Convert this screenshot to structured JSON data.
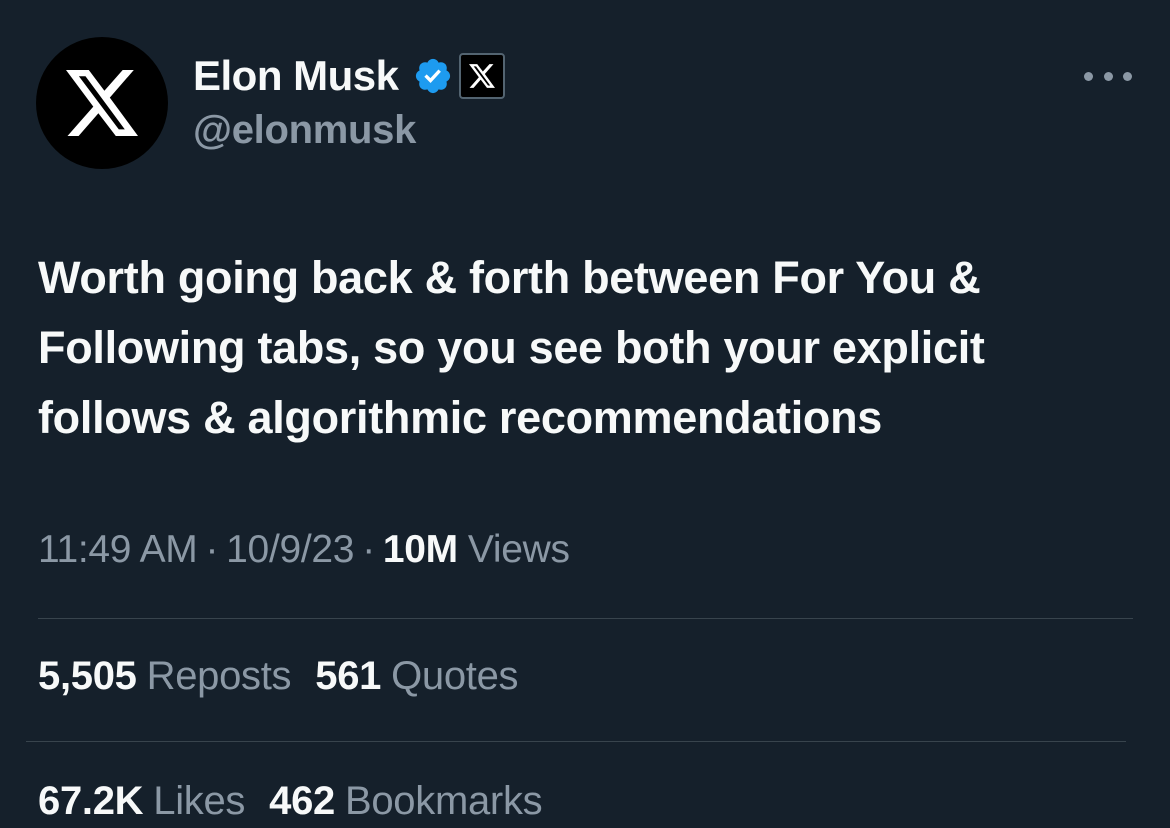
{
  "author": {
    "display_name": "Elon Musk",
    "handle": "@elonmusk",
    "avatar_icon": "x-logo-icon",
    "verified_badge_icon": "verified-badge-icon",
    "affiliate_badge_icon": "x-affiliate-badge-icon"
  },
  "more_button": {
    "icon": "more-horizontal-icon"
  },
  "tweet": {
    "text": "Worth going back & forth between For You &\nFollowing tabs, so you see both your explicit\nfollows & algorithmic recommendations"
  },
  "meta": {
    "time": "11:49 AM",
    "separator": "·",
    "date": "10/9/23",
    "views_count": "10M",
    "views_label": "Views"
  },
  "stats": {
    "reposts": {
      "count": "5,505",
      "label": "Reposts"
    },
    "quotes": {
      "count": "561",
      "label": "Quotes"
    },
    "likes": {
      "count": "67.2K",
      "label": "Likes"
    },
    "bookmarks": {
      "count": "462",
      "label": "Bookmarks"
    }
  },
  "colors": {
    "background": "#15202b",
    "primary_text": "#f7f9f9",
    "secondary_text": "#8b98a5",
    "verified_blue": "#1d9bf0",
    "divider": "#38444d"
  }
}
